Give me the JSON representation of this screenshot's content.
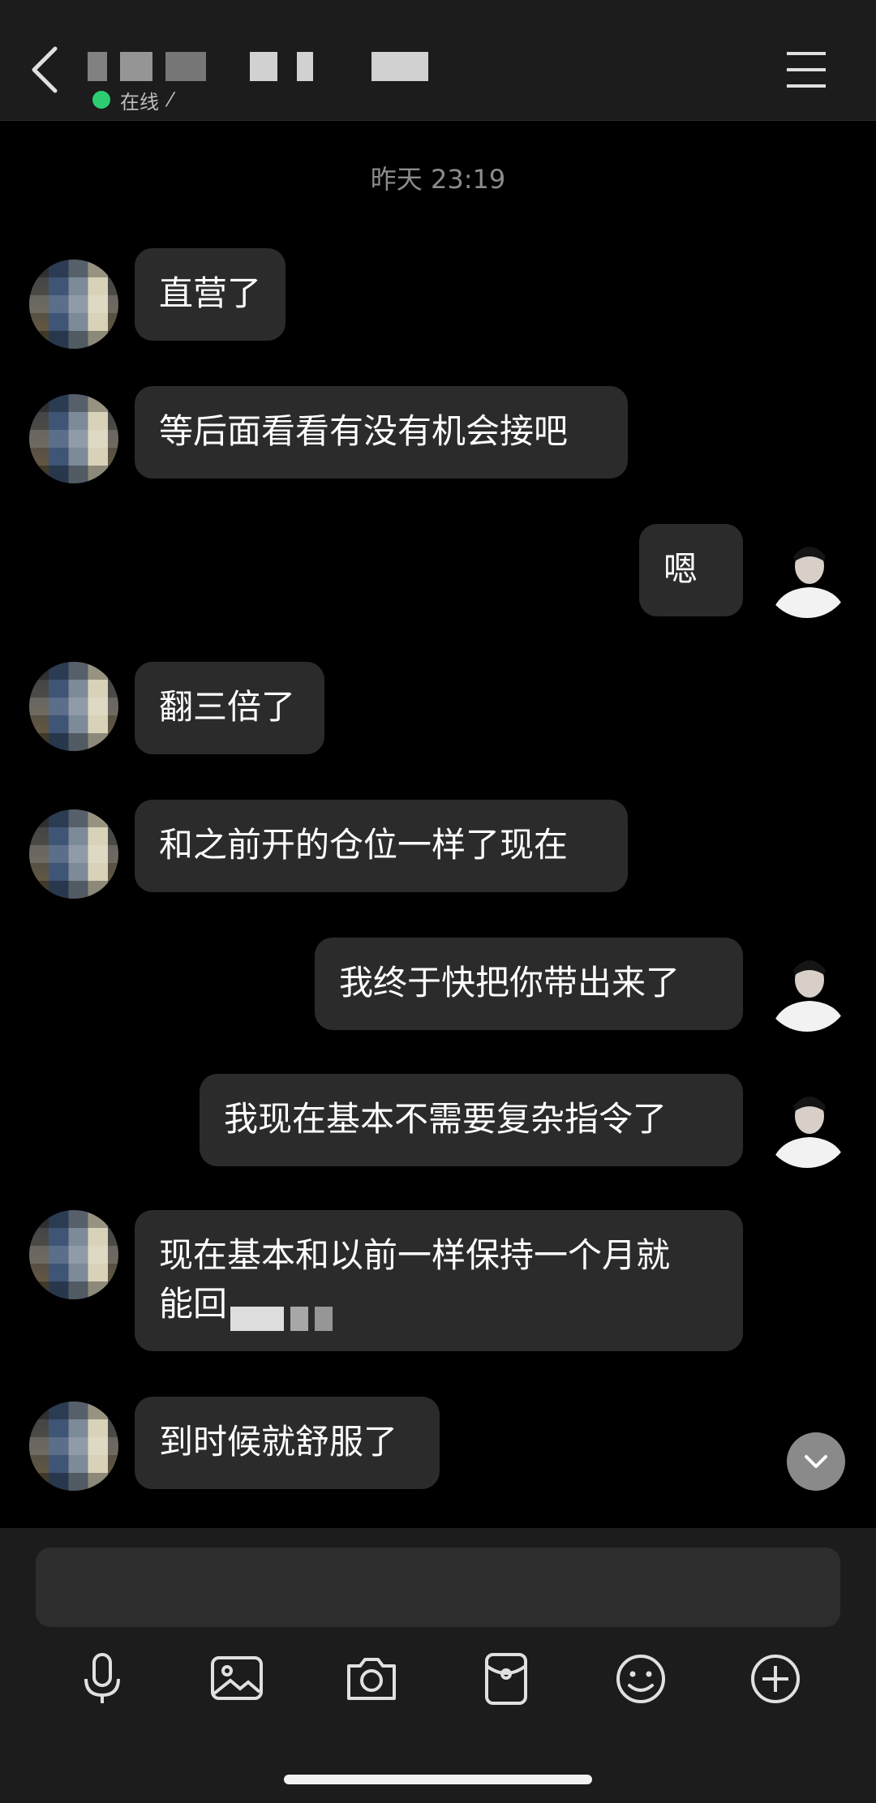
{
  "header": {
    "status_text": "在线",
    "status_edit_mark": "⁄"
  },
  "timestamp": "昨天 23:19",
  "messages": [
    {
      "side": "left",
      "text": "直营了"
    },
    {
      "side": "left",
      "text": "等后面看看有没有机会接吧"
    },
    {
      "side": "right",
      "text": "嗯"
    },
    {
      "side": "left",
      "text": "翻三倍了"
    },
    {
      "side": "left",
      "text": "和之前开的仓位一样了现在"
    },
    {
      "side": "right",
      "text": "我终于快把你带出来了"
    },
    {
      "side": "right",
      "text": "我现在基本不需要复杂指令了"
    },
    {
      "side": "left",
      "text": "现在基本和以前一样保持一个月就",
      "text_line2": "能回"
    },
    {
      "side": "left",
      "text": "到时候就舒服了"
    }
  ],
  "input": {
    "placeholder": ""
  },
  "toolbar": [
    "microphone-icon",
    "image-icon",
    "camera-icon",
    "red-packet-icon",
    "emoji-icon",
    "plus-icon"
  ],
  "colors": {
    "background": "#000000",
    "bubble": "#2b2b2b",
    "header": "#1c1c1c",
    "online": "#2ecc71"
  }
}
